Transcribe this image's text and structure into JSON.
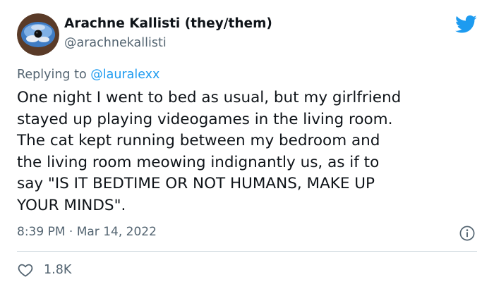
{
  "author": {
    "display_name": "Arachne Kallisti (they/them)",
    "handle": "@arachnekallisti"
  },
  "reply": {
    "prefix": "Replying to",
    "mention": "@lauralexx"
  },
  "tweet": {
    "lines": [
      "One night I went to bed as usual, but my girlfriend",
      "stayed up playing videogames in the living room.",
      "The cat kept running between my bedroom and",
      "the living room meowing indignantly us, as if to",
      "say \"IS IT BEDTIME OR NOT HUMANS, MAKE UP",
      "YOUR MINDS\"."
    ]
  },
  "meta": {
    "time": "8:39 PM",
    "separator": "·",
    "date": "Mar 14, 2022"
  },
  "actions": {
    "like_count": "1.8K"
  },
  "colors": {
    "text": "#0f1419",
    "secondary": "#536471",
    "accent": "#1d9bf0",
    "divider": "#cfd9de"
  },
  "icons": {
    "brand": "twitter-bird-icon",
    "info": "info-icon",
    "like": "heart-icon"
  }
}
